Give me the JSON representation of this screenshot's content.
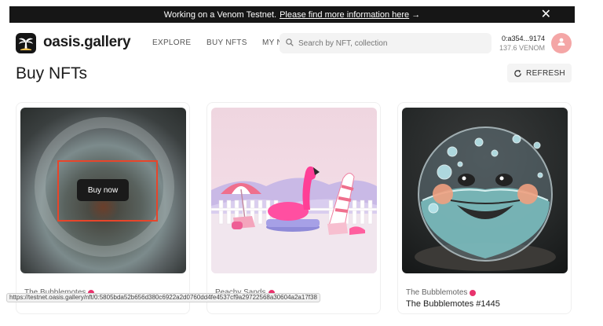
{
  "banner": {
    "text": "Working on a Venom Testnet.",
    "link": "Please find more information here",
    "arrow": "→",
    "close": "✕"
  },
  "header": {
    "brand": "oasis.gallery",
    "nav": [
      "EXPLORE",
      "BUY NFTS",
      "MY N"
    ],
    "search_placeholder": "Search by NFT, collection",
    "wallet_address": "0:a354...9174",
    "wallet_balance": "137.6 VENOM"
  },
  "page": {
    "title": "Buy NFTs",
    "refresh_label": "REFRESH"
  },
  "cards": [
    {
      "collection": "The Bubblemotes",
      "name": "",
      "action": "Buy now"
    },
    {
      "collection": "Peachy Sands",
      "name": ""
    },
    {
      "collection": "The Bubblemotes",
      "name": "The Bubblemotes #1445"
    }
  ],
  "statusbar": {
    "url": "https://testnet.oasis.gallery/nft/0:5805bda52b656d380c6922a2d0760dd4fe4537cf9a29722568a30604a2a17f38"
  },
  "colors": {
    "accent": "#e8336d",
    "highlight_box": "#e8452a",
    "banner_bg": "#161616"
  }
}
